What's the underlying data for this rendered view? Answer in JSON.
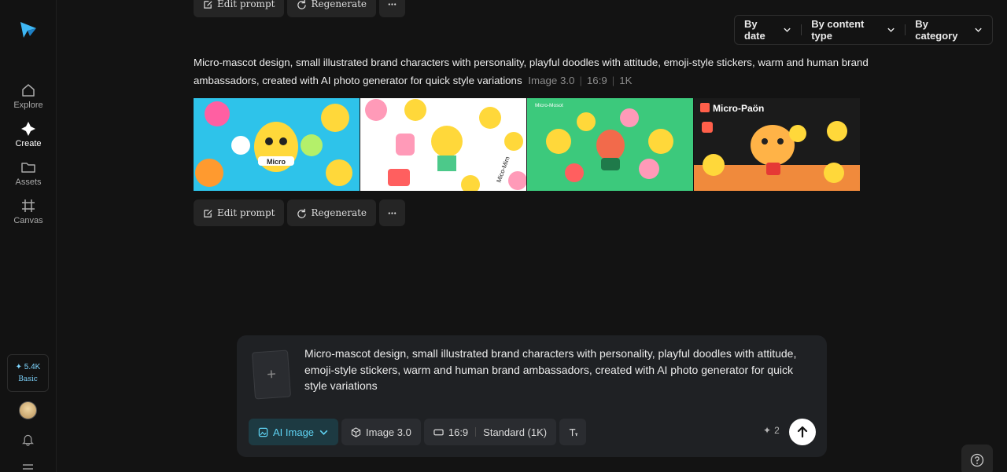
{
  "nav": {
    "items": [
      {
        "label": "Explore",
        "icon": "home-icon"
      },
      {
        "label": "Create",
        "icon": "sparkle-icon"
      },
      {
        "label": "Assets",
        "icon": "folder-icon"
      },
      {
        "label": "Canvas",
        "icon": "hash-icon"
      }
    ],
    "credits": {
      "amount": "✦ 5.4K",
      "plan": "Basic"
    }
  },
  "filters": {
    "date": "By date",
    "content_type": "By content type",
    "category": "By category"
  },
  "generation": {
    "prompt": "Micro-mascot design, small illustrated brand characters with personality, playful doodles with attitude, emoji-style stickers, warm and human brand ambassadors, created with AI photo generator for quick style variations",
    "model": "Image 3.0",
    "ratio": "16:9",
    "resolution": "1K",
    "images": [
      {
        "label": "Micro"
      },
      {
        "label": "Mico-Mim"
      },
      {
        "label": "Micro-Mosot"
      },
      {
        "label": "Micro-Paön"
      }
    ],
    "actions": {
      "edit": "Edit prompt",
      "regenerate": "Regenerate"
    }
  },
  "composer": {
    "text": "Micro-mascot design, small illustrated brand characters with personality, playful doodles with attitude, emoji-style stickers, warm and human brand ambassadors, created with AI photo generator for quick style variations",
    "mode": "AI Image",
    "model": "Image 3.0",
    "ratio": "16:9",
    "quality": "Standard (1K)",
    "cost": "2"
  },
  "colors": {
    "accent": "#5fd3f3",
    "background": "#131313",
    "panel": "#1f2124"
  }
}
